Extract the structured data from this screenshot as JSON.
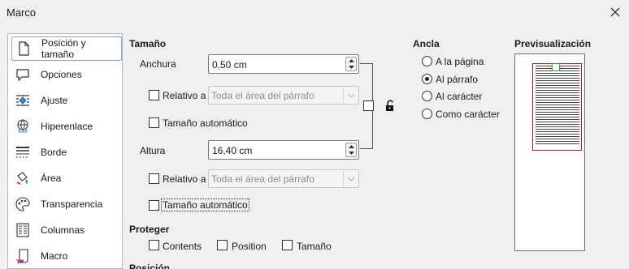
{
  "window": {
    "title": "Marco"
  },
  "sidebar": {
    "items": [
      {
        "label": "Posición y tamaño",
        "icon": "position-size-icon",
        "selected": true
      },
      {
        "label": "Opciones",
        "icon": "options-icon"
      },
      {
        "label": "Ajuste",
        "icon": "wrap-icon"
      },
      {
        "label": "Hiperenlace",
        "icon": "hyperlink-icon"
      },
      {
        "label": "Borde",
        "icon": "borders-icon"
      },
      {
        "label": "Área",
        "icon": "area-icon"
      },
      {
        "label": "Transparencia",
        "icon": "transparency-icon"
      },
      {
        "label": "Columnas",
        "icon": "columns-icon"
      },
      {
        "label": "Macro",
        "icon": "macro-icon"
      }
    ]
  },
  "size": {
    "heading": "Tamaño",
    "width_label": "Anchura",
    "width_value": "0,50 cm",
    "relative_label": "Relativo a",
    "relative_value": "Toda el área del párrafo",
    "auto_label": "Tamaño automático",
    "height_label": "Altura",
    "height_value": "16,40 cm",
    "relative2_label": "Relativo a",
    "relative2_value": "Toda el área del párrafo",
    "auto2_label": "Tamaño automático"
  },
  "protect": {
    "heading": "Proteger",
    "contents_label": "Contents",
    "position_label": "Position",
    "size_label": "Tamaño"
  },
  "position": {
    "heading": "Posición"
  },
  "anchor": {
    "heading": "Ancla",
    "options": [
      "A la página",
      "Al párrafo",
      "Al carácter",
      "Como carácter"
    ],
    "selected": "Al párrafo"
  },
  "preview": {
    "heading": "Previsualización"
  },
  "colors": {
    "accent": "#8aa8d6",
    "preview_frame": "#b21f1f",
    "anchor_marker": "#2ca52c"
  }
}
